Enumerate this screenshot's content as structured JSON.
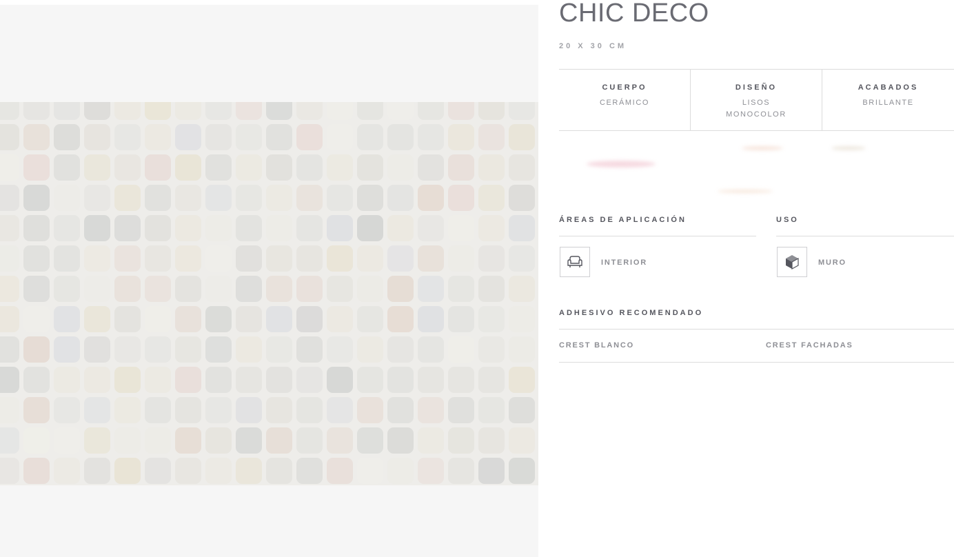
{
  "product": {
    "title": "CHIC DECO",
    "size": "20 X 30 CM"
  },
  "specs": [
    {
      "heading": "CUERPO",
      "values": [
        "CERÁMICO"
      ]
    },
    {
      "heading": "DISEÑO",
      "values": [
        "LISOS",
        "MONOCOLOR"
      ]
    },
    {
      "heading": "ACABADOS",
      "values": [
        "BRILLANTE"
      ]
    }
  ],
  "application": {
    "areas_heading": "ÁREAS DE APLICACIÓN",
    "areas_item": {
      "label": "INTERIOR",
      "icon": "armchair-icon"
    },
    "use_heading": "USO",
    "use_item": {
      "label": "MURO",
      "icon": "wall-cube-icon"
    }
  },
  "adhesive": {
    "heading": "ADHESIVO RECOMENDADO",
    "items": [
      "CREST BLANCO",
      "CREST FACHADAS"
    ]
  },
  "colors": {
    "text_dark": "#55565e",
    "text_muted": "#8e8f95",
    "border": "#dcdcdc",
    "tile_base": "#eeedea"
  }
}
